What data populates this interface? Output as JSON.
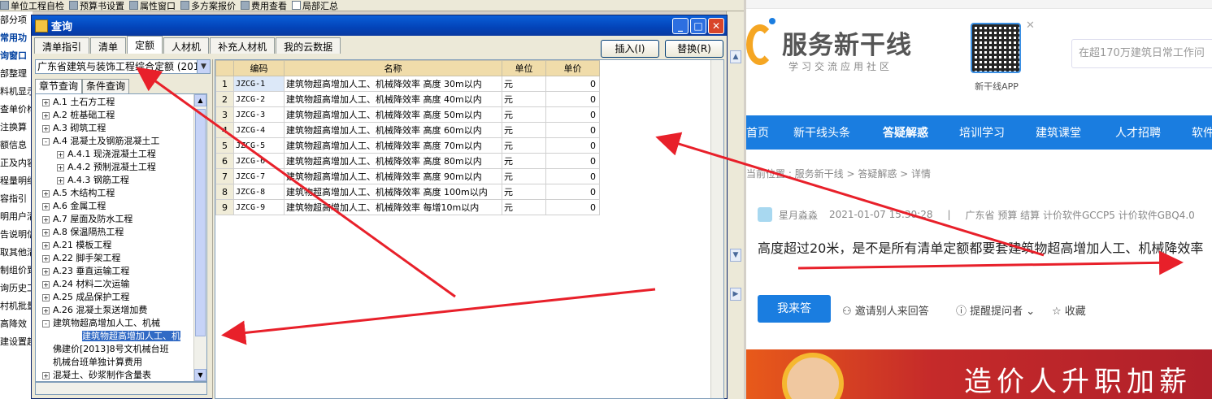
{
  "app": {
    "toolbar": [
      "单位工程自检",
      "预算书设置",
      "属性窗口",
      "多方案报价",
      "费用查看",
      "局部汇总"
    ],
    "left_panel": [
      "部分项",
      "常用功",
      "询窗口",
      "部整理",
      "料机显示",
      "查单价构",
      "注换算",
      "额信息",
      "正及内容",
      "程量明细",
      "容指引",
      "明用户清",
      "告说明信",
      "取其他清",
      "制组价到",
      "询历史工",
      "村机批量",
      "高降效",
      "建设置超"
    ],
    "colors": {
      "titlebar": "#0343b8",
      "header_bg": "#f0dcaa",
      "arrow": "#e8202a",
      "nav_blue": "#1a7de0"
    }
  },
  "dialog": {
    "title": "查询",
    "tabs": [
      "清单指引",
      "清单",
      "定额",
      "人材机",
      "补充人材机",
      "我的云数据"
    ],
    "active_tab": "定额",
    "insert_button": "插入(I)",
    "replace_button": "替换(R)",
    "standard_select": "广东省建筑与装饰工程综合定额 (201",
    "subtabs": [
      "章节查询",
      "条件查询"
    ],
    "tree": [
      {
        "label": "A.1 土石方工程",
        "level": 0,
        "toggle": "+"
      },
      {
        "label": "A.2 桩基础工程",
        "level": 0,
        "toggle": "+"
      },
      {
        "label": "A.3 砌筑工程",
        "level": 0,
        "toggle": "+"
      },
      {
        "label": "A.4 混凝土及钢筋混凝土工",
        "level": 0,
        "toggle": "-"
      },
      {
        "label": "A.4.1 现浇混凝土工程",
        "level": 1,
        "toggle": "+"
      },
      {
        "label": "A.4.2 预制混凝土工程",
        "level": 1,
        "toggle": "+"
      },
      {
        "label": "A.4.3 钢筋工程",
        "level": 1,
        "toggle": "+"
      },
      {
        "label": "A.5 木结构工程",
        "level": 0,
        "toggle": "+"
      },
      {
        "label": "A.6 金属工程",
        "level": 0,
        "toggle": "+"
      },
      {
        "label": "A.7 屋面及防水工程",
        "level": 0,
        "toggle": "+"
      },
      {
        "label": "A.8 保温隔热工程",
        "level": 0,
        "toggle": "+"
      },
      {
        "label": "A.21 模板工程",
        "level": 0,
        "toggle": "+"
      },
      {
        "label": "A.22 脚手架工程",
        "level": 0,
        "toggle": "+"
      },
      {
        "label": "A.23 垂直运输工程",
        "level": 0,
        "toggle": "+"
      },
      {
        "label": "A.24 材料二次运输",
        "level": 0,
        "toggle": "+"
      },
      {
        "label": "A.25 成品保护工程",
        "level": 0,
        "toggle": "+"
      },
      {
        "label": "A.26 混凝土泵送增加费",
        "level": 0,
        "toggle": "+"
      },
      {
        "label": "建筑物超高增加人工、机械",
        "level": 0,
        "toggle": "-"
      },
      {
        "label": "建筑物超高增加人工、机",
        "level": 2,
        "toggle": "",
        "selected": true
      },
      {
        "label": "佛建价[2013]8号文机械台班",
        "level": 0,
        "toggle": ""
      },
      {
        "label": "机械台班单独计算费用",
        "level": 0,
        "toggle": ""
      },
      {
        "label": "混凝土、砂浆制作含量表",
        "level": 0,
        "toggle": "+"
      }
    ],
    "grid": {
      "headers": [
        "编码",
        "名称",
        "单位",
        "单价"
      ],
      "rows": [
        {
          "n": "1",
          "code": "JZCG-1",
          "name": "建筑物超高增加人工、机械降效率 高度 30m以内",
          "unit": "元",
          "price": "0"
        },
        {
          "n": "2",
          "code": "JZCG-2",
          "name": "建筑物超高增加人工、机械降效率 高度 40m以内",
          "unit": "元",
          "price": "0"
        },
        {
          "n": "3",
          "code": "JZCG-3",
          "name": "建筑物超高增加人工、机械降效率 高度 50m以内",
          "unit": "元",
          "price": "0"
        },
        {
          "n": "4",
          "code": "JZCG-4",
          "name": "建筑物超高增加人工、机械降效率 高度 60m以内",
          "unit": "元",
          "price": "0"
        },
        {
          "n": "5",
          "code": "JZCG-5",
          "name": "建筑物超高增加人工、机械降效率 高度 70m以内",
          "unit": "元",
          "price": "0"
        },
        {
          "n": "6",
          "code": "JZCG-6",
          "name": "建筑物超高增加人工、机械降效率 高度 80m以内",
          "unit": "元",
          "price": "0"
        },
        {
          "n": "7",
          "code": "JZCG-7",
          "name": "建筑物超高增加人工、机械降效率 高度 90m以内",
          "unit": "元",
          "price": "0"
        },
        {
          "n": "8",
          "code": "JZCG-8",
          "name": "建筑物超高增加人工、机械降效率 高度 100m以内",
          "unit": "元",
          "price": "0"
        },
        {
          "n": "9",
          "code": "JZCG-9",
          "name": "建筑物超高增加人工、机械降效率 每增10m以内",
          "unit": "元",
          "price": "0"
        }
      ]
    }
  },
  "web": {
    "logo": "服务新干线",
    "logo_sub": "学习交流应用社区",
    "qr_label": "新干线APP",
    "search_placeholder": "在超170万建筑日常工作问",
    "nav": [
      "首页",
      "新干线头条",
      "答疑解惑",
      "培训学习",
      "建筑课堂",
      "人才招聘",
      "软件"
    ],
    "breadcrumb": "当前位置 : 服务新干线 > 答疑解惑 > 详情",
    "author": "星月淼淼",
    "date": "2021-01-07 15:30:28",
    "tags": "广东省  预算 结算 计价软件GCCP5 计价软件GBQ4.0",
    "question": "高度超过20米，是不是所有清单定额都要套建筑物超高增加人工、机械降效率",
    "answer_button": "我来答",
    "invite": "邀请别人来回答",
    "remind": "提醒提问者",
    "collect": "收藏",
    "banner": "造价人升职加薪"
  }
}
